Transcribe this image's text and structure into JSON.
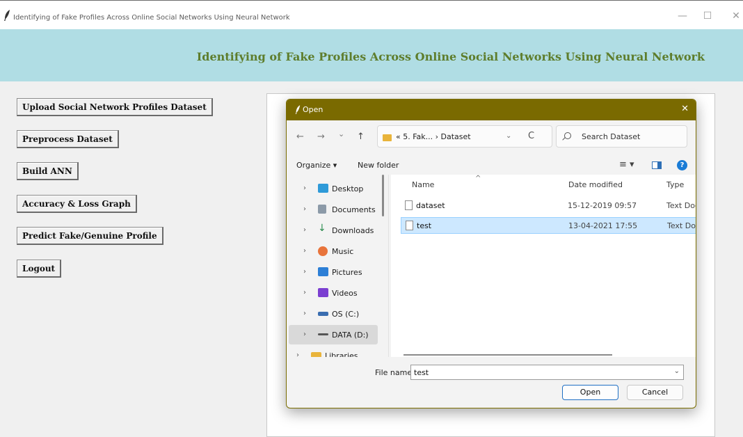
{
  "window": {
    "title": "Identifying of Fake Profiles Across Online Social Networks Using Neural Network",
    "minimize": "—",
    "maximize": "☐",
    "close": "✕"
  },
  "header": {
    "heading": "Identifying of Fake Profiles Across Online Social Networks Using Neural Network",
    "banner_color": "#b0dde4",
    "heading_color": "#5e7d2c"
  },
  "sidebar": {
    "buttons": [
      {
        "label": "Upload Social Network Profiles Dataset"
      },
      {
        "label": "Preprocess Dataset"
      },
      {
        "label": "Build ANN"
      },
      {
        "label": "Accuracy & Loss Graph"
      },
      {
        "label": "Predict Fake/Genuine Profile"
      },
      {
        "label": "Logout"
      }
    ]
  },
  "dialog": {
    "title": "Open",
    "title_bar_color": "#7a6a00",
    "nav": {
      "back": "←",
      "forward": "→",
      "recent": "⌄",
      "up": "↑",
      "breadcrumb": "«  5. Fak...  ›  Dataset",
      "dropdown": "⌄",
      "refresh": "C",
      "search_placeholder": "Search Dataset"
    },
    "toolbar": {
      "organize": "Organize ▾",
      "new_folder": "New folder",
      "view": "≡ ▾",
      "help": "?"
    },
    "nav_pane": [
      {
        "label": "Desktop",
        "icon": "desktop-icon",
        "color": "#2f9ad8"
      },
      {
        "label": "Documents",
        "icon": "documents-icon",
        "color": "#8c9aa8"
      },
      {
        "label": "Downloads",
        "icon": "downloads-icon",
        "color": "#2b8c4f"
      },
      {
        "label": "Music",
        "icon": "music-icon",
        "color": "#e8743b"
      },
      {
        "label": "Pictures",
        "icon": "pictures-icon",
        "color": "#2d7fd6"
      },
      {
        "label": "Videos",
        "icon": "videos-icon",
        "color": "#7b3fd1"
      },
      {
        "label": "OS (C:)",
        "icon": "drive-c-icon",
        "color": "#3a6db0"
      },
      {
        "label": "DATA (D:)",
        "icon": "drive-d-icon",
        "color": "#555555"
      },
      {
        "label": "Libraries",
        "icon": "libraries-icon",
        "color": "#e9b43b"
      }
    ],
    "nav_arrow": "›",
    "columns": {
      "name": "Name",
      "date": "Date modified",
      "type": "Type",
      "sort_caret": "^"
    },
    "files": [
      {
        "name": "dataset",
        "date": "15-12-2019 09:57",
        "type": "Text Document",
        "selected": false
      },
      {
        "name": "test",
        "date": "13-04-2021 17:55",
        "type": "Text Document",
        "selected": true
      }
    ],
    "file_name_label": "File name:",
    "file_name_value": "test",
    "file_name_dropdown": "⌄",
    "open_label": "Open",
    "cancel_label": "Cancel"
  }
}
